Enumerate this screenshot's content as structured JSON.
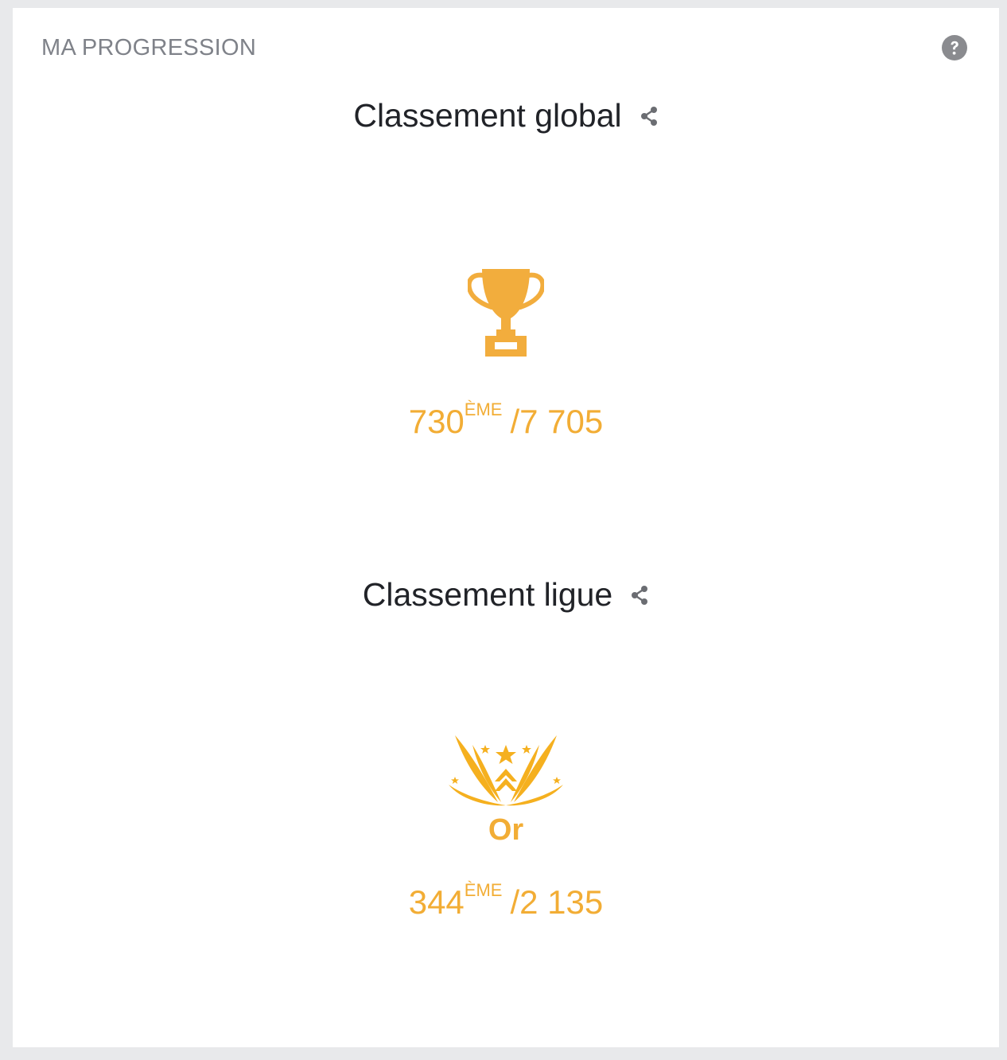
{
  "card": {
    "title": "MA PROGRESSION",
    "help_icon": "question-circle-icon"
  },
  "global": {
    "heading": "Classement global",
    "share_icon": "share-icon",
    "trophy_icon": "trophy-icon",
    "rank": "730",
    "rank_suffix": "ÈME",
    "total": "/7 705"
  },
  "league": {
    "heading": "Classement ligue",
    "share_icon": "share-icon",
    "league_icon": "gold-league-emblem-icon",
    "name": "Or",
    "rank": "344",
    "rank_suffix": "ÈME",
    "total": "/2 135"
  },
  "colors": {
    "accent": "#f2ad35",
    "text_dark": "#212328",
    "text_muted": "#7f8289",
    "background": "#e8e9eb",
    "card": "#ffffff",
    "help_icon": "#8a8b8f"
  }
}
